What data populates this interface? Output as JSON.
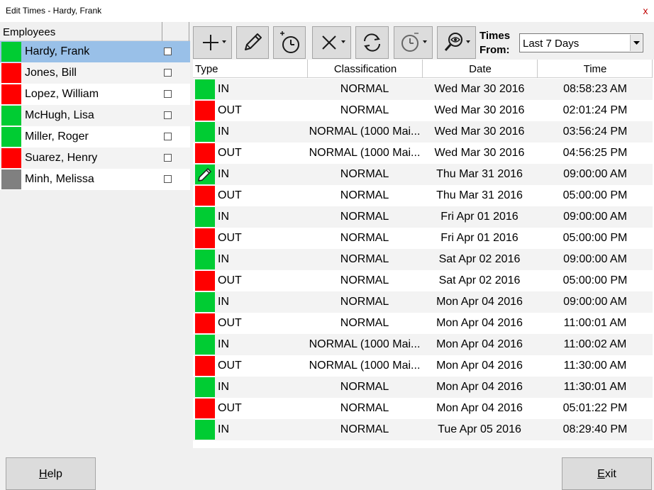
{
  "window": {
    "title": "Edit Times - Hardy, Frank",
    "close_glyph": "x"
  },
  "employees": {
    "header": "Employees",
    "items": [
      {
        "name": "Hardy, Frank",
        "status_color": "#00cc33",
        "selected": true,
        "checked": false
      },
      {
        "name": "Jones, Bill",
        "status_color": "#ff0000",
        "selected": false,
        "checked": false
      },
      {
        "name": "Lopez, William",
        "status_color": "#ff0000",
        "selected": false,
        "checked": false
      },
      {
        "name": "McHugh, Lisa",
        "status_color": "#00cc33",
        "selected": false,
        "checked": false
      },
      {
        "name": "Miller, Roger",
        "status_color": "#00cc33",
        "selected": false,
        "checked": false
      },
      {
        "name": "Suarez, Henry",
        "status_color": "#ff0000",
        "selected": false,
        "checked": false
      },
      {
        "name": "Minh, Melissa",
        "status_color": "#808080",
        "selected": false,
        "checked": false
      }
    ]
  },
  "toolbar": {
    "buttons": [
      {
        "icon": "plus-dropdown-icon",
        "name": "add-button"
      },
      {
        "icon": "pencil-icon",
        "name": "edit-button"
      },
      {
        "icon": "add-clock-icon",
        "name": "add-punch-button"
      },
      {
        "icon": "x-dropdown-icon",
        "name": "delete-button"
      },
      {
        "icon": "refresh-icon",
        "name": "refresh-button"
      },
      {
        "icon": "clock-dropdown-icon",
        "name": "time-options-button"
      },
      {
        "icon": "eye-search-icon",
        "name": "view-button"
      }
    ],
    "times_from_line1": "Times",
    "times_from_line2": "From:",
    "times_from_value": "Last 7 Days"
  },
  "table": {
    "columns": [
      "Type",
      "Classification",
      "Date",
      "Time"
    ],
    "rows": [
      {
        "type": "IN",
        "color": "#00cc33",
        "editing": false,
        "classification": "NORMAL",
        "date": "Wed Mar 30 2016",
        "time": "08:58:23 AM"
      },
      {
        "type": "OUT",
        "color": "#ff0000",
        "editing": false,
        "classification": "NORMAL",
        "date": "Wed Mar 30 2016",
        "time": "02:01:24 PM"
      },
      {
        "type": "IN",
        "color": "#00cc33",
        "editing": false,
        "classification": "NORMAL (1000 Mai...",
        "date": "Wed Mar 30 2016",
        "time": "03:56:24 PM"
      },
      {
        "type": "OUT",
        "color": "#ff0000",
        "editing": false,
        "classification": "NORMAL (1000 Mai...",
        "date": "Wed Mar 30 2016",
        "time": "04:56:25 PM"
      },
      {
        "type": "IN",
        "color": "#00cc33",
        "editing": true,
        "classification": "NORMAL",
        "date": "Thu Mar 31 2016",
        "time": "09:00:00 AM"
      },
      {
        "type": "OUT",
        "color": "#ff0000",
        "editing": false,
        "classification": "NORMAL",
        "date": "Thu Mar 31 2016",
        "time": "05:00:00 PM"
      },
      {
        "type": "IN",
        "color": "#00cc33",
        "editing": false,
        "classification": "NORMAL",
        "date": "Fri Apr 01 2016",
        "time": "09:00:00 AM"
      },
      {
        "type": "OUT",
        "color": "#ff0000",
        "editing": false,
        "classification": "NORMAL",
        "date": "Fri Apr 01 2016",
        "time": "05:00:00 PM"
      },
      {
        "type": "IN",
        "color": "#00cc33",
        "editing": false,
        "classification": "NORMAL",
        "date": "Sat Apr 02 2016",
        "time": "09:00:00 AM"
      },
      {
        "type": "OUT",
        "color": "#ff0000",
        "editing": false,
        "classification": "NORMAL",
        "date": "Sat Apr 02 2016",
        "time": "05:00:00 PM"
      },
      {
        "type": "IN",
        "color": "#00cc33",
        "editing": false,
        "classification": "NORMAL",
        "date": "Mon Apr 04 2016",
        "time": "09:00:00 AM"
      },
      {
        "type": "OUT",
        "color": "#ff0000",
        "editing": false,
        "classification": "NORMAL",
        "date": "Mon Apr 04 2016",
        "time": "11:00:01 AM"
      },
      {
        "type": "IN",
        "color": "#00cc33",
        "editing": false,
        "classification": "NORMAL (1000 Mai...",
        "date": "Mon Apr 04 2016",
        "time": "11:00:02 AM"
      },
      {
        "type": "OUT",
        "color": "#ff0000",
        "editing": false,
        "classification": "NORMAL (1000 Mai...",
        "date": "Mon Apr 04 2016",
        "time": "11:30:00 AM"
      },
      {
        "type": "IN",
        "color": "#00cc33",
        "editing": false,
        "classification": "NORMAL",
        "date": "Mon Apr 04 2016",
        "time": "11:30:01 AM"
      },
      {
        "type": "OUT",
        "color": "#ff0000",
        "editing": false,
        "classification": "NORMAL",
        "date": "Mon Apr 04 2016",
        "time": "05:01:22 PM"
      },
      {
        "type": "IN",
        "color": "#00cc33",
        "editing": false,
        "classification": "NORMAL",
        "date": "Tue Apr 05 2016",
        "time": "08:29:40 PM"
      }
    ]
  },
  "footer": {
    "help_label": "Help",
    "help_accel": "H",
    "help_rest": "elp",
    "exit_label": "Exit",
    "exit_accel": "E",
    "exit_rest": "xit"
  }
}
